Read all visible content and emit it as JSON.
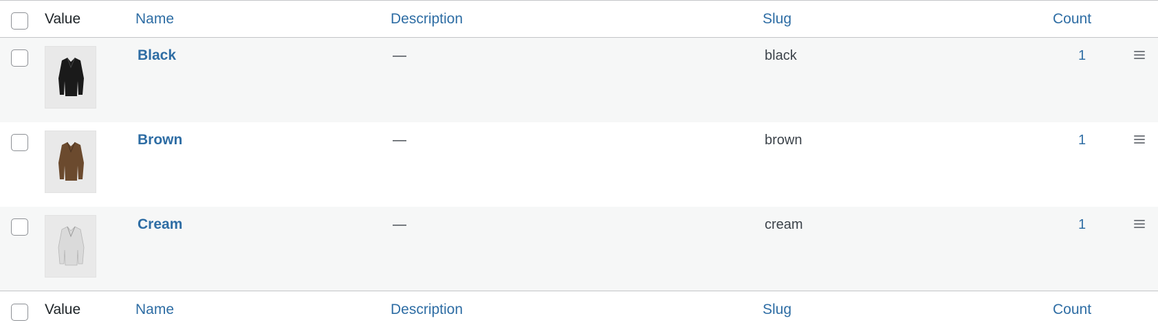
{
  "columns": {
    "value": "Value",
    "name": "Name",
    "description": "Description",
    "slug": "Slug",
    "count": "Count"
  },
  "rows": [
    {
      "name": "Black",
      "description": "—",
      "slug": "black",
      "count": "1",
      "thumb_color": "#1a1a1a"
    },
    {
      "name": "Brown",
      "description": "—",
      "slug": "brown",
      "count": "1",
      "thumb_color": "#6b4a2e"
    },
    {
      "name": "Cream",
      "description": "—",
      "slug": "cream",
      "count": "1",
      "thumb_color": "#d9d9d9"
    }
  ],
  "colors": {
    "link": "#2e6da4",
    "row_alt_bg": "#f6f7f7",
    "border": "#c3c4c7"
  }
}
